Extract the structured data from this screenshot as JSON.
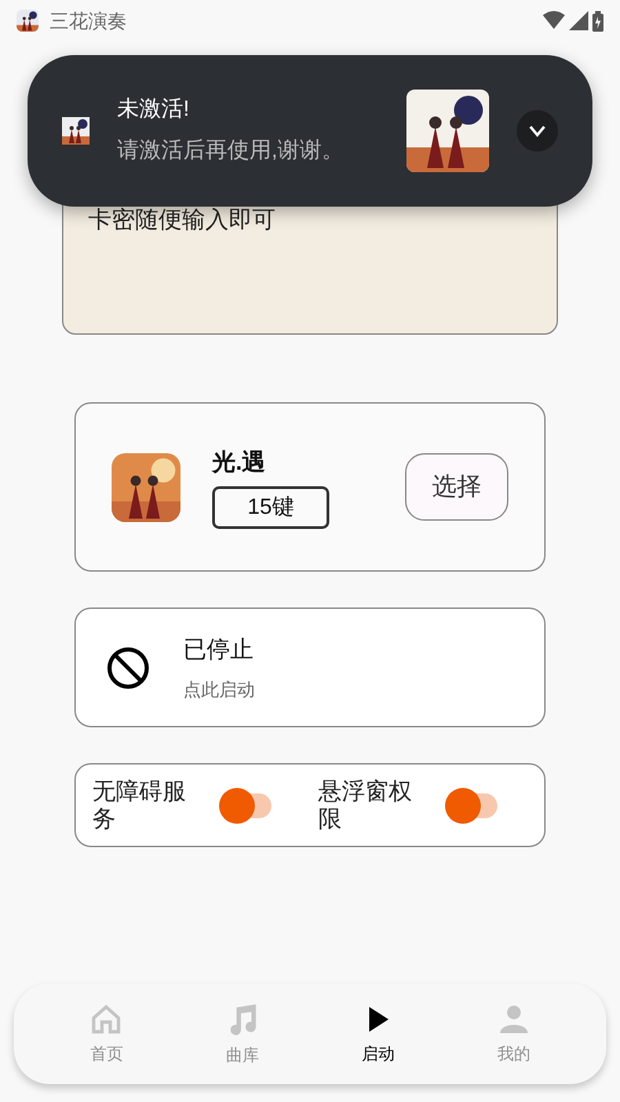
{
  "status_bar": {
    "app_title": "三花演奏"
  },
  "notification": {
    "title": "未激活!",
    "message": "请激活后再使用,谢谢。",
    "expanded": false
  },
  "key_field": {
    "value": "卡密随便输入即可"
  },
  "game_card": {
    "name": "光.遇",
    "keys": "15键",
    "button": "选择"
  },
  "status_card": {
    "running": false,
    "title": "已停止",
    "subtitle": "点此启动"
  },
  "permissions": [
    {
      "label": "无障碍服务",
      "on": false
    },
    {
      "label": "悬浮窗权限",
      "on": false
    }
  ],
  "nav": [
    {
      "label": "首页",
      "kind": "home",
      "selected": false
    },
    {
      "label": "曲库",
      "kind": "music",
      "selected": false
    },
    {
      "label": "启动",
      "kind": "play",
      "selected": true
    },
    {
      "label": "我的",
      "kind": "person",
      "selected": false
    }
  ]
}
